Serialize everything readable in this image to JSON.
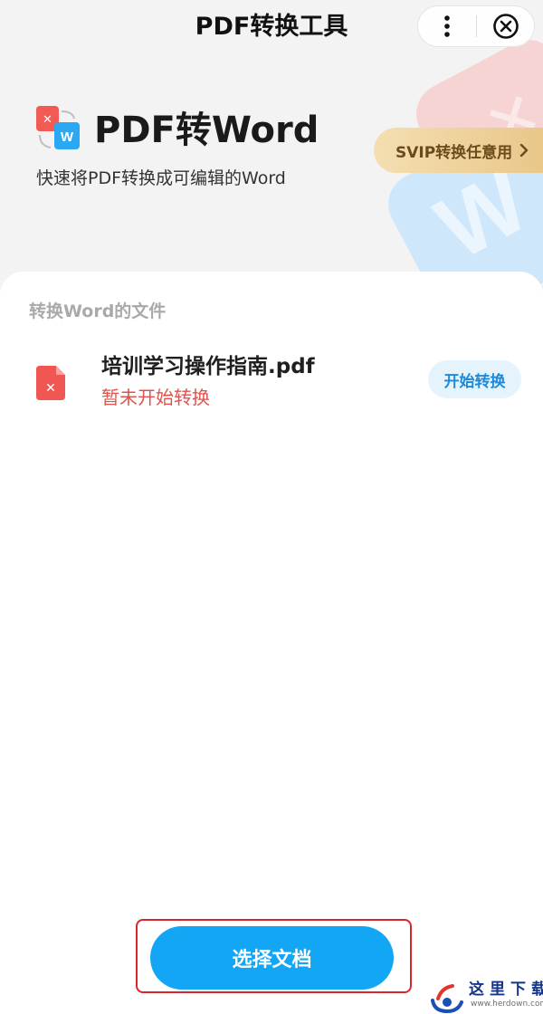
{
  "nav": {
    "title": "PDF转换工具",
    "more_icon": "more-dots-icon",
    "close_icon": "close-circle-icon"
  },
  "hero": {
    "title": "PDF转Word",
    "subtitle": "快速将PDF转换成可编辑的Word",
    "svip_label": "SVIP转换任意用",
    "logo_icon": "pdf-to-word-icon"
  },
  "files": {
    "section_label": "转换Word的文件",
    "items": [
      {
        "name": "培训学习操作指南.pdf",
        "status": "暂未开始转换",
        "action": "开始转换",
        "icon": "pdf-file-icon"
      }
    ]
  },
  "footer": {
    "select_button": "选择文档"
  },
  "watermark": {
    "title": "这里下载",
    "url": "www.herdown.com"
  },
  "colors": {
    "primary": "#12a6f5",
    "status_red": "#e0534d",
    "svip_gold": "#e9c789",
    "highlight_red": "#d9262c"
  }
}
